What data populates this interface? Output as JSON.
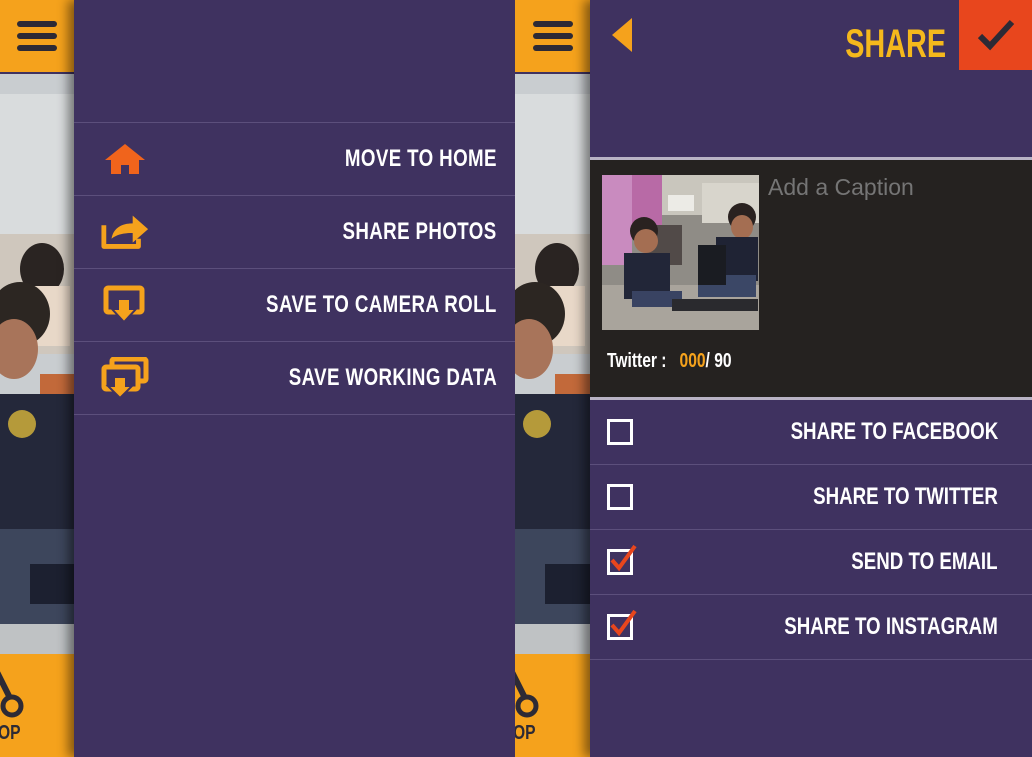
{
  "left_screen": {
    "menu_items": [
      {
        "label": "MOVE TO HOME",
        "icon": "home-icon"
      },
      {
        "label": "SHARE PHOTOS",
        "icon": "share-icon"
      },
      {
        "label": "SAVE TO CAMERA ROLL",
        "icon": "save-camera-roll-icon"
      },
      {
        "label": "SAVE WORKING DATA",
        "icon": "save-working-data-icon"
      }
    ],
    "crop_label": "OP"
  },
  "right_screen": {
    "title": "SHARE",
    "caption_placeholder": "Add a Caption",
    "twitter_label": "Twitter :",
    "twitter_current": "000",
    "twitter_max": "/  90",
    "options": [
      {
        "label": "SHARE TO FACEBOOK",
        "checked": false
      },
      {
        "label": "SHARE TO TWITTER",
        "checked": false
      },
      {
        "label": "SEND TO EMAIL",
        "checked": true
      },
      {
        "label": "SHARE TO INSTAGRAM",
        "checked": true
      }
    ],
    "crop_label": "OP"
  },
  "colors": {
    "panel_bg": "#3f3260",
    "accent_orange": "#f5a21c",
    "confirm_red": "#e8461d",
    "home_icon_orange": "#f0641c",
    "divider": "#5c4f7c",
    "caption_bg": "#252220"
  }
}
